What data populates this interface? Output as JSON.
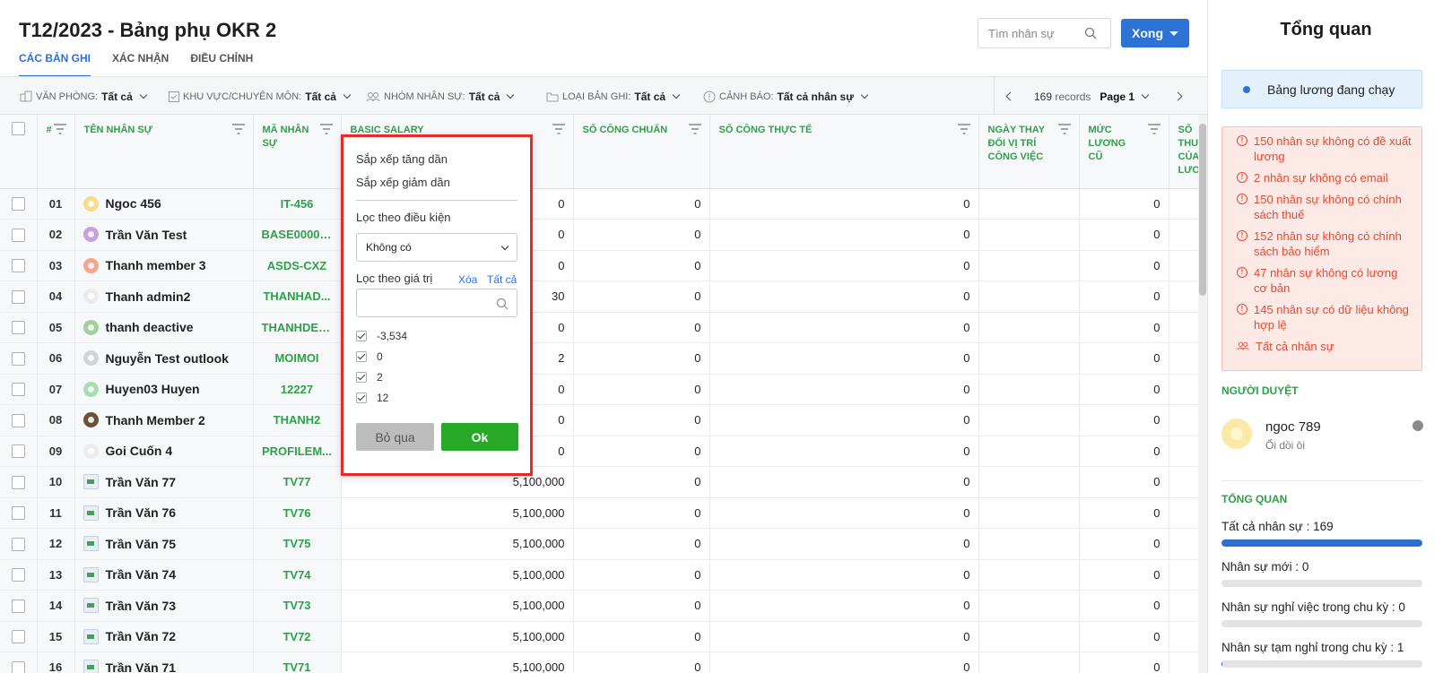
{
  "page": {
    "title": "T12/2023 - Bảng phụ OKR 2",
    "tabs": [
      {
        "label": "CÁC BẢN GHI",
        "active": true
      },
      {
        "label": "XÁC NHẬN",
        "active": false
      },
      {
        "label": "ĐIỀU CHỈNH",
        "active": false
      }
    ]
  },
  "header": {
    "search_placeholder": "Tìm nhân sự",
    "done_button": "Xong"
  },
  "filters": [
    {
      "label": "VĂN PHÒNG:",
      "value": "Tất cả",
      "icon": "office-icon"
    },
    {
      "label": "KHU VỰC/CHUYÊN MÔN:",
      "value": "Tất cả",
      "icon": "checkbox-icon"
    },
    {
      "label": "NHÓM NHÂN SỰ:",
      "value": "Tất cả",
      "icon": "users-icon"
    },
    {
      "label": "LOẠI BẢN GHI:",
      "value": "Tất cả",
      "icon": "folder-icon"
    },
    {
      "label": "CẢNH BÁO:",
      "value": "Tất cả nhân sự",
      "icon": "warning-icon"
    }
  ],
  "pager": {
    "records_count": "169",
    "records_label": "records",
    "page_label": "Page 1"
  },
  "table": {
    "columns": [
      "#",
      "TÊN NHÂN SỰ",
      "MÃ NHÂN SỰ",
      "BASIC SALARY",
      "SỐ CÔNG CHUẨN",
      "SỐ CÔNG THỰC TẾ",
      "NGÀY THAY ĐỔI VỊ TRÍ CÔNG VIỆC",
      "MỨC LƯƠNG CŨ",
      "SỐ THU CỦA LƯƠ"
    ],
    "rows": [
      {
        "no": "01",
        "name": "Ngoc 456",
        "code": "IT-456",
        "basic": "0",
        "cong_chuan": "0",
        "cong_thuc_te": "0",
        "ngay_thay": "",
        "luong_cu": "0",
        "avatar": "#f8dc86"
      },
      {
        "no": "02",
        "name": "Trần Văn Test",
        "code": "BASE00000...",
        "basic": "0",
        "cong_chuan": "0",
        "cong_thuc_te": "0",
        "ngay_thay": "",
        "luong_cu": "0",
        "avatar": "#c6a2df"
      },
      {
        "no": "03",
        "name": "Thanh member 3",
        "code": "ASDS-CXZ",
        "basic": "0",
        "cong_chuan": "0",
        "cong_thuc_te": "0",
        "ngay_thay": "",
        "luong_cu": "0",
        "avatar": "#f5a48e"
      },
      {
        "no": "04",
        "name": "Thanh admin2",
        "code": "THANHAD...",
        "basic": "30",
        "cong_chuan": "0",
        "cong_thuc_te": "0",
        "ngay_thay": "",
        "luong_cu": "0",
        "avatar": "#ececec"
      },
      {
        "no": "05",
        "name": "thanh deactive",
        "code": "THANHDEA...",
        "basic": "0",
        "cong_chuan": "0",
        "cong_thuc_te": "0",
        "ngay_thay": "",
        "luong_cu": "0",
        "avatar": "#9fd29b"
      },
      {
        "no": "06",
        "name": "Nguyễn Test outlook",
        "code": "MOIMOI",
        "basic": "2",
        "cong_chuan": "0",
        "cong_thuc_te": "0",
        "ngay_thay": "",
        "luong_cu": "0",
        "avatar": "#d4d4d4"
      },
      {
        "no": "07",
        "name": "Huyen03 Huyen",
        "code": "12227",
        "basic": "0",
        "cong_chuan": "0",
        "cong_thuc_te": "0",
        "ngay_thay": "",
        "luong_cu": "0",
        "avatar": "#a6dfb5"
      },
      {
        "no": "08",
        "name": "Thanh Member 2",
        "code": "THANH2",
        "basic": "0",
        "cong_chuan": "0",
        "cong_thuc_te": "0",
        "ngay_thay": "",
        "luong_cu": "0",
        "avatar": "#6b5138"
      },
      {
        "no": "09",
        "name": "Goi Cuốn 4",
        "code": "PROFILEM...",
        "basic": "0",
        "cong_chuan": "0",
        "cong_thuc_te": "0",
        "ngay_thay": "",
        "luong_cu": "0",
        "avatar": "#ececec"
      },
      {
        "no": "10",
        "name": "Trần Văn 77",
        "code": "TV77",
        "basic": "5,100,000",
        "cong_chuan": "0",
        "cong_thuc_te": "0",
        "ngay_thay": "",
        "luong_cu": "0",
        "avatar": "image"
      },
      {
        "no": "11",
        "name": "Trần Văn 76",
        "code": "TV76",
        "basic": "5,100,000",
        "cong_chuan": "0",
        "cong_thuc_te": "0",
        "ngay_thay": "",
        "luong_cu": "0",
        "avatar": "image"
      },
      {
        "no": "12",
        "name": "Trần Văn 75",
        "code": "TV75",
        "basic": "5,100,000",
        "cong_chuan": "0",
        "cong_thuc_te": "0",
        "ngay_thay": "",
        "luong_cu": "0",
        "avatar": "image"
      },
      {
        "no": "13",
        "name": "Trần Văn 74",
        "code": "TV74",
        "basic": "5,100,000",
        "cong_chuan": "0",
        "cong_thuc_te": "0",
        "ngay_thay": "",
        "luong_cu": "0",
        "avatar": "image"
      },
      {
        "no": "14",
        "name": "Trần Văn 73",
        "code": "TV73",
        "basic": "5,100,000",
        "cong_chuan": "0",
        "cong_thuc_te": "0",
        "ngay_thay": "",
        "luong_cu": "0",
        "avatar": "image"
      },
      {
        "no": "15",
        "name": "Trần Văn 72",
        "code": "TV72",
        "basic": "5,100,000",
        "cong_chuan": "0",
        "cong_thuc_te": "0",
        "ngay_thay": "",
        "luong_cu": "0",
        "avatar": "image"
      },
      {
        "no": "16",
        "name": "Trần Văn 71",
        "code": "TV71",
        "basic": "5,100,000",
        "cong_chuan": "0",
        "cong_thuc_te": "0",
        "ngay_thay": "",
        "luong_cu": "0",
        "avatar": "image"
      }
    ]
  },
  "dropdown": {
    "sort_asc": "Sắp xếp tăng dần",
    "sort_desc": "Sắp xếp giảm dần",
    "filter_condition_label": "Lọc theo điều kiện",
    "condition_value": "Không có",
    "filter_value_label": "Lọc theo giá trị",
    "clear_link": "Xóa",
    "all_link": "Tất cả",
    "options": [
      "-3,534",
      "0",
      "2",
      "12"
    ],
    "skip_button": "Bỏ qua",
    "ok_button": "Ok"
  },
  "sidebar": {
    "title": "Tổng quan",
    "status": "Bảng lương đang chạy",
    "warnings": [
      "150 nhân sự không có đề xuất lương",
      "2 nhân sự không có email",
      "150 nhân sự không có chính sách thuế",
      "152 nhân sự không có chính sách bảo hiểm",
      "47 nhân sự không có lương cơ bản",
      "145 nhân sự có dữ liệu không hợp lệ"
    ],
    "all_staff_link": "Tất cả nhân sự",
    "approver_heading": "NGƯỜI DUYỆT",
    "approver": {
      "name": "ngoc 789",
      "subtitle": "Ối dồi ôi"
    },
    "overview_heading": "TỔNG QUAN",
    "stats": [
      {
        "label": "Tất cả nhân sự : 169",
        "fraction": 1
      },
      {
        "label": "Nhân sự mới : 0",
        "fraction": 0
      },
      {
        "label": "Nhân sự nghỉ việc trong chu kỳ : 0",
        "fraction": 0
      },
      {
        "label": "Nhân sự tạm nghỉ trong chu kỳ : 1",
        "fraction": 0.006
      }
    ]
  },
  "colors": {
    "accent": "#2d73d6",
    "green": "#2ea04a",
    "warning": "#e24b32",
    "highlight": "#e32b2b"
  }
}
